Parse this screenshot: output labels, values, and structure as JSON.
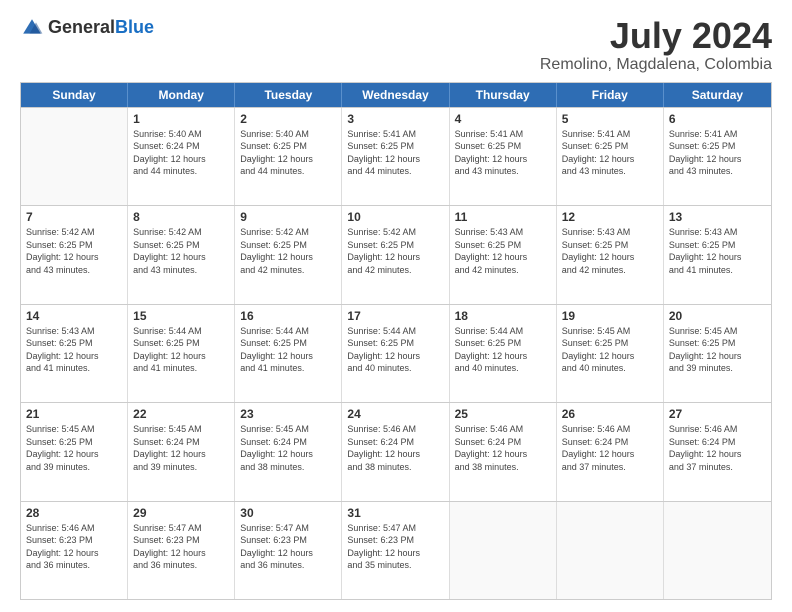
{
  "logo": {
    "general": "General",
    "blue": "Blue"
  },
  "title": "July 2024",
  "subtitle": "Remolino, Magdalena, Colombia",
  "calendar": {
    "days": [
      "Sunday",
      "Monday",
      "Tuesday",
      "Wednesday",
      "Thursday",
      "Friday",
      "Saturday"
    ],
    "weeks": [
      [
        {
          "day": "",
          "content": ""
        },
        {
          "day": "1",
          "content": "Sunrise: 5:40 AM\nSunset: 6:24 PM\nDaylight: 12 hours\nand 44 minutes."
        },
        {
          "day": "2",
          "content": "Sunrise: 5:40 AM\nSunset: 6:25 PM\nDaylight: 12 hours\nand 44 minutes."
        },
        {
          "day": "3",
          "content": "Sunrise: 5:41 AM\nSunset: 6:25 PM\nDaylight: 12 hours\nand 44 minutes."
        },
        {
          "day": "4",
          "content": "Sunrise: 5:41 AM\nSunset: 6:25 PM\nDaylight: 12 hours\nand 43 minutes."
        },
        {
          "day": "5",
          "content": "Sunrise: 5:41 AM\nSunset: 6:25 PM\nDaylight: 12 hours\nand 43 minutes."
        },
        {
          "day": "6",
          "content": "Sunrise: 5:41 AM\nSunset: 6:25 PM\nDaylight: 12 hours\nand 43 minutes."
        }
      ],
      [
        {
          "day": "7",
          "content": "Sunrise: 5:42 AM\nSunset: 6:25 PM\nDaylight: 12 hours\nand 43 minutes."
        },
        {
          "day": "8",
          "content": "Sunrise: 5:42 AM\nSunset: 6:25 PM\nDaylight: 12 hours\nand 43 minutes."
        },
        {
          "day": "9",
          "content": "Sunrise: 5:42 AM\nSunset: 6:25 PM\nDaylight: 12 hours\nand 42 minutes."
        },
        {
          "day": "10",
          "content": "Sunrise: 5:42 AM\nSunset: 6:25 PM\nDaylight: 12 hours\nand 42 minutes."
        },
        {
          "day": "11",
          "content": "Sunrise: 5:43 AM\nSunset: 6:25 PM\nDaylight: 12 hours\nand 42 minutes."
        },
        {
          "day": "12",
          "content": "Sunrise: 5:43 AM\nSunset: 6:25 PM\nDaylight: 12 hours\nand 42 minutes."
        },
        {
          "day": "13",
          "content": "Sunrise: 5:43 AM\nSunset: 6:25 PM\nDaylight: 12 hours\nand 41 minutes."
        }
      ],
      [
        {
          "day": "14",
          "content": "Sunrise: 5:43 AM\nSunset: 6:25 PM\nDaylight: 12 hours\nand 41 minutes."
        },
        {
          "day": "15",
          "content": "Sunrise: 5:44 AM\nSunset: 6:25 PM\nDaylight: 12 hours\nand 41 minutes."
        },
        {
          "day": "16",
          "content": "Sunrise: 5:44 AM\nSunset: 6:25 PM\nDaylight: 12 hours\nand 41 minutes."
        },
        {
          "day": "17",
          "content": "Sunrise: 5:44 AM\nSunset: 6:25 PM\nDaylight: 12 hours\nand 40 minutes."
        },
        {
          "day": "18",
          "content": "Sunrise: 5:44 AM\nSunset: 6:25 PM\nDaylight: 12 hours\nand 40 minutes."
        },
        {
          "day": "19",
          "content": "Sunrise: 5:45 AM\nSunset: 6:25 PM\nDaylight: 12 hours\nand 40 minutes."
        },
        {
          "day": "20",
          "content": "Sunrise: 5:45 AM\nSunset: 6:25 PM\nDaylight: 12 hours\nand 39 minutes."
        }
      ],
      [
        {
          "day": "21",
          "content": "Sunrise: 5:45 AM\nSunset: 6:25 PM\nDaylight: 12 hours\nand 39 minutes."
        },
        {
          "day": "22",
          "content": "Sunrise: 5:45 AM\nSunset: 6:24 PM\nDaylight: 12 hours\nand 39 minutes."
        },
        {
          "day": "23",
          "content": "Sunrise: 5:45 AM\nSunset: 6:24 PM\nDaylight: 12 hours\nand 38 minutes."
        },
        {
          "day": "24",
          "content": "Sunrise: 5:46 AM\nSunset: 6:24 PM\nDaylight: 12 hours\nand 38 minutes."
        },
        {
          "day": "25",
          "content": "Sunrise: 5:46 AM\nSunset: 6:24 PM\nDaylight: 12 hours\nand 38 minutes."
        },
        {
          "day": "26",
          "content": "Sunrise: 5:46 AM\nSunset: 6:24 PM\nDaylight: 12 hours\nand 37 minutes."
        },
        {
          "day": "27",
          "content": "Sunrise: 5:46 AM\nSunset: 6:24 PM\nDaylight: 12 hours\nand 37 minutes."
        }
      ],
      [
        {
          "day": "28",
          "content": "Sunrise: 5:46 AM\nSunset: 6:23 PM\nDaylight: 12 hours\nand 36 minutes."
        },
        {
          "day": "29",
          "content": "Sunrise: 5:47 AM\nSunset: 6:23 PM\nDaylight: 12 hours\nand 36 minutes."
        },
        {
          "day": "30",
          "content": "Sunrise: 5:47 AM\nSunset: 6:23 PM\nDaylight: 12 hours\nand 36 minutes."
        },
        {
          "day": "31",
          "content": "Sunrise: 5:47 AM\nSunset: 6:23 PM\nDaylight: 12 hours\nand 35 minutes."
        },
        {
          "day": "",
          "content": ""
        },
        {
          "day": "",
          "content": ""
        },
        {
          "day": "",
          "content": ""
        }
      ]
    ]
  }
}
